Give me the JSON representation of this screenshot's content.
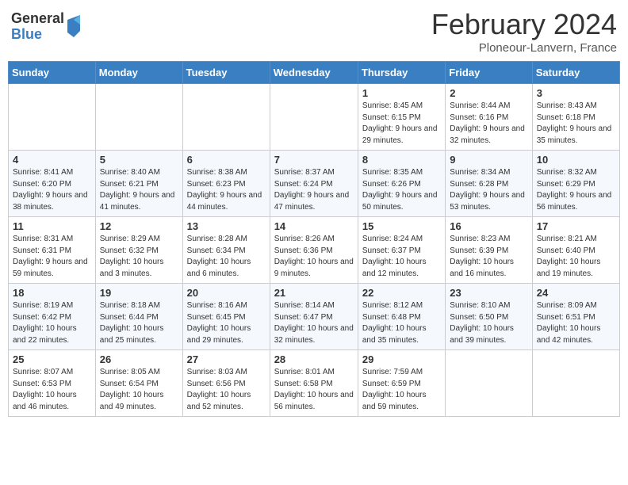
{
  "logo": {
    "general": "General",
    "blue": "Blue"
  },
  "header": {
    "month": "February 2024",
    "location": "Ploneour-Lanvern, France"
  },
  "days_of_week": [
    "Sunday",
    "Monday",
    "Tuesday",
    "Wednesday",
    "Thursday",
    "Friday",
    "Saturday"
  ],
  "weeks": [
    [
      {
        "day": "",
        "info": ""
      },
      {
        "day": "",
        "info": ""
      },
      {
        "day": "",
        "info": ""
      },
      {
        "day": "",
        "info": ""
      },
      {
        "day": "1",
        "info": "Sunrise: 8:45 AM\nSunset: 6:15 PM\nDaylight: 9 hours and 29 minutes."
      },
      {
        "day": "2",
        "info": "Sunrise: 8:44 AM\nSunset: 6:16 PM\nDaylight: 9 hours and 32 minutes."
      },
      {
        "day": "3",
        "info": "Sunrise: 8:43 AM\nSunset: 6:18 PM\nDaylight: 9 hours and 35 minutes."
      }
    ],
    [
      {
        "day": "4",
        "info": "Sunrise: 8:41 AM\nSunset: 6:20 PM\nDaylight: 9 hours and 38 minutes."
      },
      {
        "day": "5",
        "info": "Sunrise: 8:40 AM\nSunset: 6:21 PM\nDaylight: 9 hours and 41 minutes."
      },
      {
        "day": "6",
        "info": "Sunrise: 8:38 AM\nSunset: 6:23 PM\nDaylight: 9 hours and 44 minutes."
      },
      {
        "day": "7",
        "info": "Sunrise: 8:37 AM\nSunset: 6:24 PM\nDaylight: 9 hours and 47 minutes."
      },
      {
        "day": "8",
        "info": "Sunrise: 8:35 AM\nSunset: 6:26 PM\nDaylight: 9 hours and 50 minutes."
      },
      {
        "day": "9",
        "info": "Sunrise: 8:34 AM\nSunset: 6:28 PM\nDaylight: 9 hours and 53 minutes."
      },
      {
        "day": "10",
        "info": "Sunrise: 8:32 AM\nSunset: 6:29 PM\nDaylight: 9 hours and 56 minutes."
      }
    ],
    [
      {
        "day": "11",
        "info": "Sunrise: 8:31 AM\nSunset: 6:31 PM\nDaylight: 9 hours and 59 minutes."
      },
      {
        "day": "12",
        "info": "Sunrise: 8:29 AM\nSunset: 6:32 PM\nDaylight: 10 hours and 3 minutes."
      },
      {
        "day": "13",
        "info": "Sunrise: 8:28 AM\nSunset: 6:34 PM\nDaylight: 10 hours and 6 minutes."
      },
      {
        "day": "14",
        "info": "Sunrise: 8:26 AM\nSunset: 6:36 PM\nDaylight: 10 hours and 9 minutes."
      },
      {
        "day": "15",
        "info": "Sunrise: 8:24 AM\nSunset: 6:37 PM\nDaylight: 10 hours and 12 minutes."
      },
      {
        "day": "16",
        "info": "Sunrise: 8:23 AM\nSunset: 6:39 PM\nDaylight: 10 hours and 16 minutes."
      },
      {
        "day": "17",
        "info": "Sunrise: 8:21 AM\nSunset: 6:40 PM\nDaylight: 10 hours and 19 minutes."
      }
    ],
    [
      {
        "day": "18",
        "info": "Sunrise: 8:19 AM\nSunset: 6:42 PM\nDaylight: 10 hours and 22 minutes."
      },
      {
        "day": "19",
        "info": "Sunrise: 8:18 AM\nSunset: 6:44 PM\nDaylight: 10 hours and 25 minutes."
      },
      {
        "day": "20",
        "info": "Sunrise: 8:16 AM\nSunset: 6:45 PM\nDaylight: 10 hours and 29 minutes."
      },
      {
        "day": "21",
        "info": "Sunrise: 8:14 AM\nSunset: 6:47 PM\nDaylight: 10 hours and 32 minutes."
      },
      {
        "day": "22",
        "info": "Sunrise: 8:12 AM\nSunset: 6:48 PM\nDaylight: 10 hours and 35 minutes."
      },
      {
        "day": "23",
        "info": "Sunrise: 8:10 AM\nSunset: 6:50 PM\nDaylight: 10 hours and 39 minutes."
      },
      {
        "day": "24",
        "info": "Sunrise: 8:09 AM\nSunset: 6:51 PM\nDaylight: 10 hours and 42 minutes."
      }
    ],
    [
      {
        "day": "25",
        "info": "Sunrise: 8:07 AM\nSunset: 6:53 PM\nDaylight: 10 hours and 46 minutes."
      },
      {
        "day": "26",
        "info": "Sunrise: 8:05 AM\nSunset: 6:54 PM\nDaylight: 10 hours and 49 minutes."
      },
      {
        "day": "27",
        "info": "Sunrise: 8:03 AM\nSunset: 6:56 PM\nDaylight: 10 hours and 52 minutes."
      },
      {
        "day": "28",
        "info": "Sunrise: 8:01 AM\nSunset: 6:58 PM\nDaylight: 10 hours and 56 minutes."
      },
      {
        "day": "29",
        "info": "Sunrise: 7:59 AM\nSunset: 6:59 PM\nDaylight: 10 hours and 59 minutes."
      },
      {
        "day": "",
        "info": ""
      },
      {
        "day": "",
        "info": ""
      }
    ]
  ]
}
